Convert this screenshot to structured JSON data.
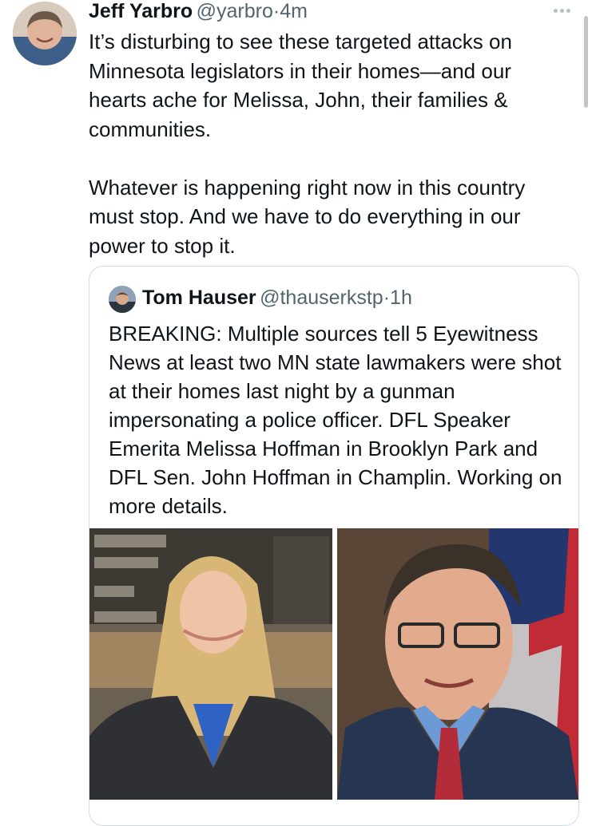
{
  "tweet": {
    "author_name": "Jeff Yarbro",
    "author_handle": "@yarbro",
    "separator": "·",
    "time": "4m",
    "paragraphs": [
      "It’s disturbing to see these targeted attacks on Minnesota legislators in their homes—and our hearts ache for Melissa, John, their families & communities.",
      "Whatever is happening right now in this country must stop. And we have to do everything in our power to stop it."
    ]
  },
  "quoted_tweet": {
    "author_name": "Tom Hauser",
    "author_handle": "@thauserkstp",
    "separator": "·",
    "time": "1h",
    "text": "BREAKING: Multiple sources tell 5 Eyewitness News at least two MN state lawmakers were shot at their homes last night by a gunman impersonating a police officer. DFL Speaker Emerita Melissa Hoffman in Brooklyn Park and DFL Sen. John Hoffman in Champlin. Working on more details.",
    "photo_count": 2
  },
  "colors": {
    "text_primary": "#0f1419",
    "text_secondary": "#536471",
    "border": "#d6dbe0"
  },
  "icons": [
    "more-options-icon"
  ]
}
